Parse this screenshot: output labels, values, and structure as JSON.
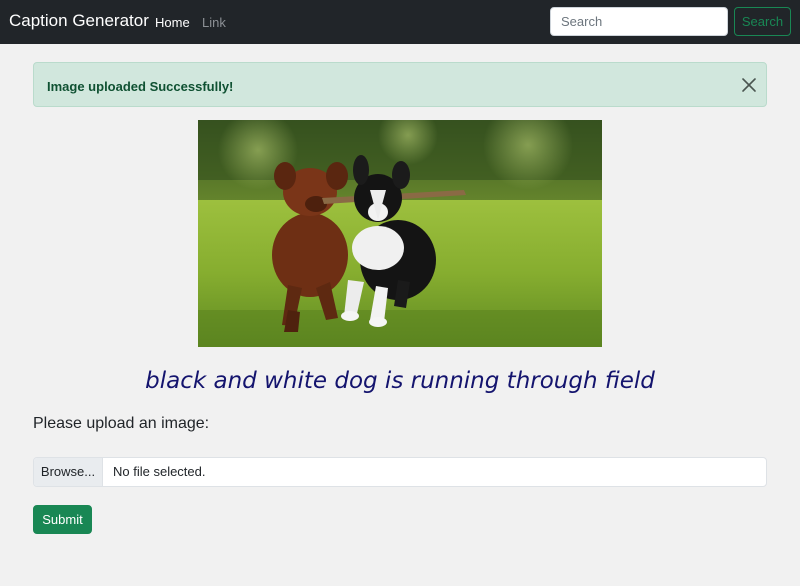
{
  "navbar": {
    "brand": "Caption Generator",
    "links": [
      "Home",
      "Link"
    ],
    "search_placeholder": "Search",
    "search_button": "Search"
  },
  "alert": {
    "message": "Image uploaded Successfully!",
    "close_icon": "close-icon"
  },
  "image": {
    "description_icon": "uploaded-photo"
  },
  "caption": "black and white dog is running through field",
  "upload": {
    "label": "Please upload an image:",
    "browse_label": "Browse...",
    "file_status": "No file selected.",
    "submit_label": "Submit"
  },
  "colors": {
    "navbar_bg": "#212529",
    "success": "#198754",
    "alert_bg": "#d1e7dd",
    "alert_text": "#0f5132",
    "caption": "#14146e",
    "page_bg": "#f1f1f1"
  }
}
